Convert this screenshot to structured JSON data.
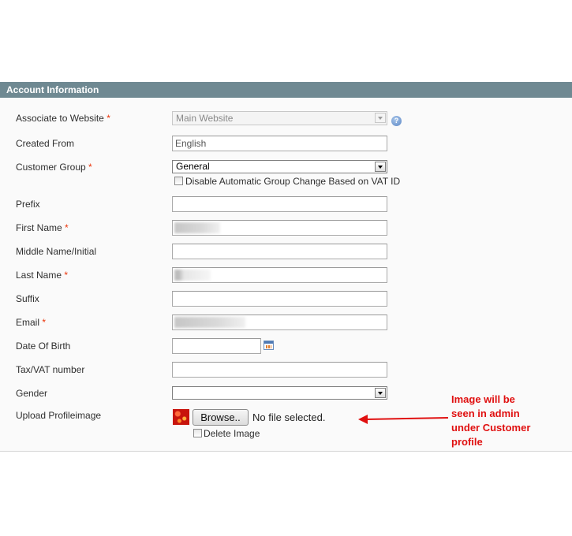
{
  "section": {
    "title": "Account Information"
  },
  "fields": {
    "website": {
      "label": "Associate to Website",
      "required": "*",
      "value": "Main Website"
    },
    "created_from": {
      "label": "Created From",
      "value": "English"
    },
    "customer_group": {
      "label": "Customer Group",
      "required": "*",
      "value": "General",
      "vat_checkbox_label": "Disable Automatic Group Change Based on VAT ID"
    },
    "prefix": {
      "label": "Prefix",
      "value": ""
    },
    "first_name": {
      "label": "First Name",
      "required": "*"
    },
    "middle_name": {
      "label": "Middle Name/Initial",
      "value": ""
    },
    "last_name": {
      "label": "Last Name",
      "required": "*"
    },
    "suffix": {
      "label": "Suffix",
      "value": ""
    },
    "email": {
      "label": "Email",
      "required": "*"
    },
    "dob": {
      "label": "Date Of Birth",
      "value": ""
    },
    "taxvat": {
      "label": "Tax/VAT number",
      "value": ""
    },
    "gender": {
      "label": "Gender",
      "value": ""
    },
    "profile_image": {
      "label": "Upload Profileimage",
      "browse_label": "Browse..",
      "file_status": "No file selected.",
      "delete_label": "Delete Image"
    }
  },
  "annotation": {
    "lines": [
      "Image will be",
      "seen in admin",
      "under Customer",
      "profile"
    ],
    "color": "#e01010"
  },
  "icons": {
    "help": "help-icon",
    "calendar": "calendar-icon",
    "dropdown": "chevron-down-icon"
  },
  "colors": {
    "header_bg": "#6f8992",
    "required": "#eb340a"
  }
}
